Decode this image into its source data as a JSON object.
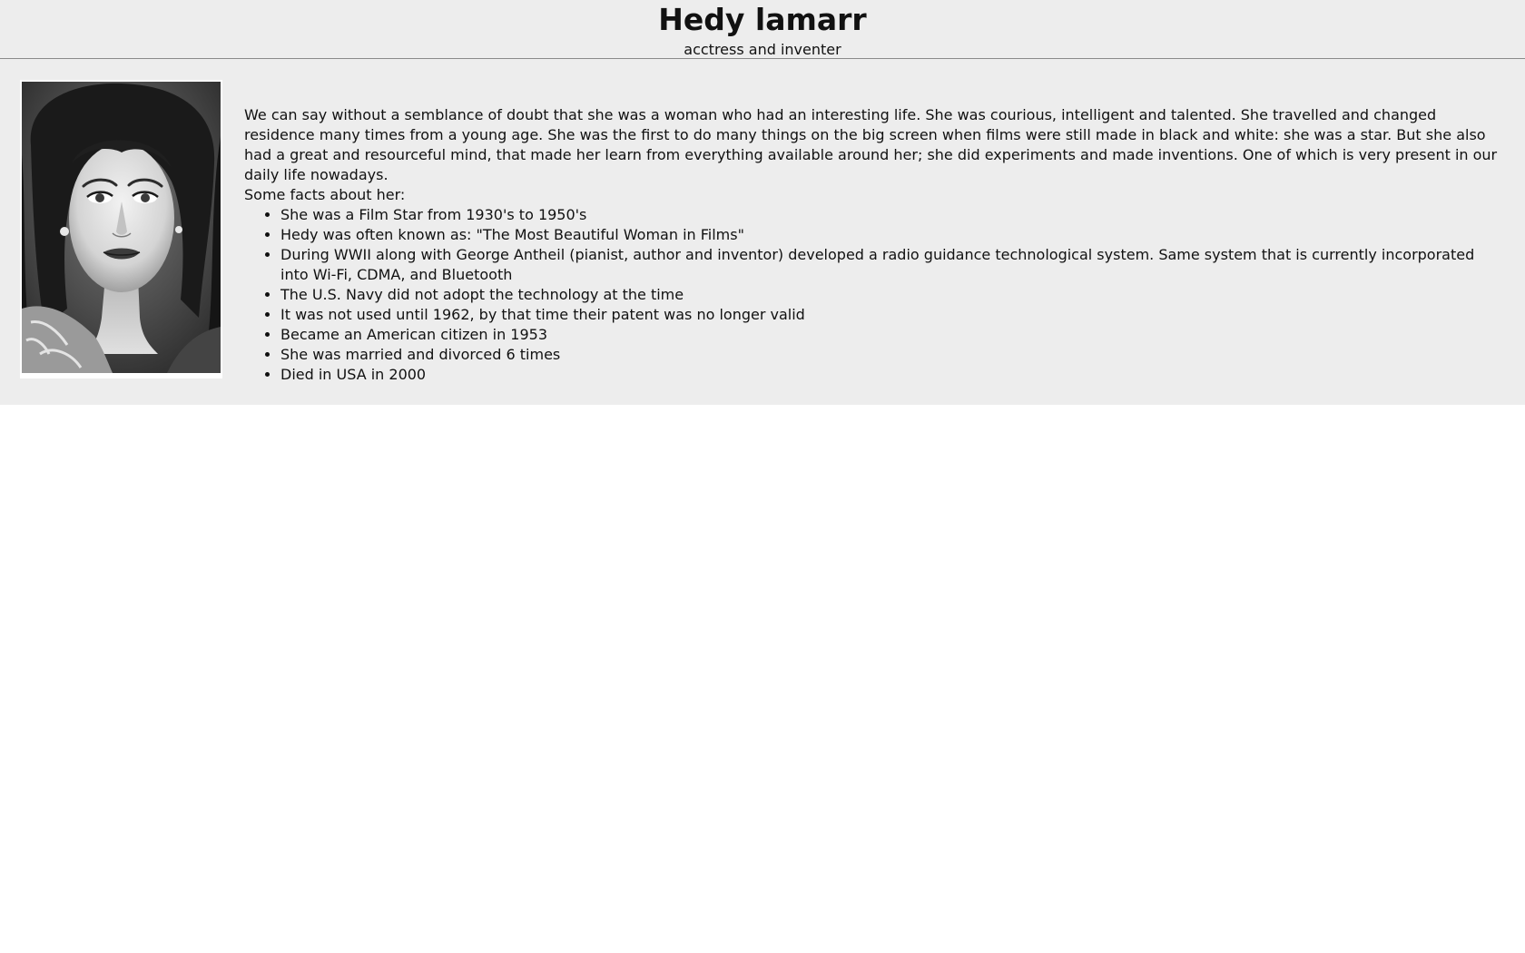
{
  "header": {
    "title": "Hedy lamarr",
    "subtitle": "acctress and inventer"
  },
  "portrait": {
    "subject": "Hedy Lamarr portrait"
  },
  "main": {
    "intro": "We can say without a semblance of doubt that she was a woman who had an interesting life. She was courious, intelligent and talented. She travelled and changed residence many times from a young age. She was the first to do many things on the big screen when films were still made in black and white: she was a star. But she also had a great and resourceful mind, that made her learn from everything available around her; she did experiments and made inventions. One of which is very present in our daily life nowadays.",
    "facts_label": "Some facts about her:",
    "facts": [
      "She was a Film Star from 1930's to 1950's",
      "Hedy was often known as: \"The Most Beautiful Woman in Films\"",
      "During WWII along with George Antheil (pianist, author and inventor) developed a radio guidance technological system. Same system that is currently incorporated into Wi-Fi, CDMA, and Bluetooth",
      "The U.S. Navy did not adopt the technology at the time",
      "It was not used until 1962, by that time their patent was no longer valid",
      "Became an American citizen in 1953",
      "She was married and divorced 6 times",
      "Died in USA in 2000"
    ]
  }
}
